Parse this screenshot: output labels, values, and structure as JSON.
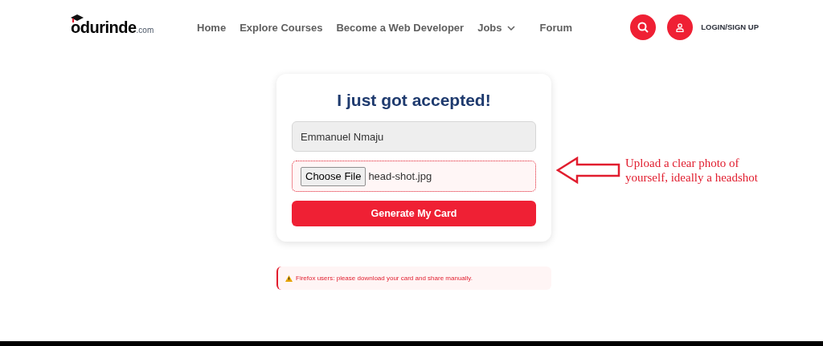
{
  "header": {
    "logo": {
      "name": "odurinde",
      "suffix": ".com"
    },
    "nav": [
      {
        "label": "Home",
        "dropdown": false
      },
      {
        "label": "Explore Courses",
        "dropdown": false
      },
      {
        "label": "Become a Web Developer",
        "dropdown": false
      },
      {
        "label": "Jobs",
        "dropdown": true
      },
      {
        "label": "Forum",
        "dropdown": false
      }
    ],
    "login": "LOGIN/SIGN UP"
  },
  "card": {
    "title": "I just got accepted!",
    "name_value": "Emmanuel Nmaju",
    "file_button": "Choose File",
    "file_name": "head-shot.jpg",
    "submit": "Generate My Card"
  },
  "hint": "Upload a clear photo of yourself, ideally a headshot",
  "alert": "Firefox users: please download your card and share manually."
}
